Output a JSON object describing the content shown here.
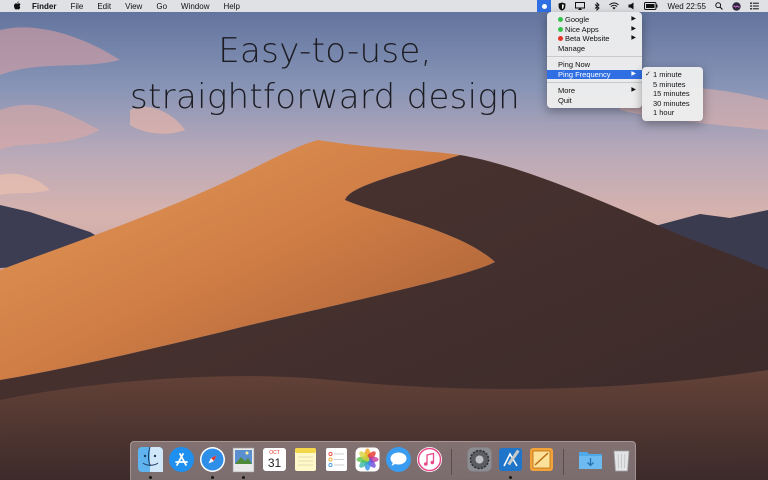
{
  "headline": {
    "line1": "Easy-to-use,",
    "line2": "straightforward design"
  },
  "menubar": {
    "app_name": "Finder",
    "menus": [
      "File",
      "Edit",
      "View",
      "Go",
      "Window",
      "Help"
    ],
    "clock": "Wed 22:55"
  },
  "main_menu": {
    "sites": [
      {
        "label": "Google",
        "status_color": "#36c24a"
      },
      {
        "label": "Nice Apps",
        "status_color": "#36c24a"
      },
      {
        "label": "Beta Website",
        "status_color": "#e5332a"
      }
    ],
    "manage": "Manage",
    "ping_now": "Ping Now",
    "ping_frequency": "Ping Frequency",
    "more": "More",
    "quit": "Quit"
  },
  "frequency_menu": {
    "options": [
      "1 minute",
      "5 minutes",
      "15 minutes",
      "30 minutes",
      "1 hour"
    ],
    "selected": "1 minute"
  },
  "dock": {
    "icons": [
      "finder-icon",
      "app-store-icon",
      "safari-icon",
      "preview-icon",
      "calendar-icon",
      "notes-icon",
      "reminders-icon",
      "photos-icon",
      "messages-icon",
      "itunes-icon",
      "system-preferences-icon",
      "xcode-icon",
      "sketch-app-icon",
      "downloads-folder-icon",
      "trash-icon"
    ],
    "calendar_month": "OCT",
    "calendar_day": "31"
  },
  "colors": {
    "accent": "#2f6fe3",
    "menubar": "#eceaec"
  }
}
